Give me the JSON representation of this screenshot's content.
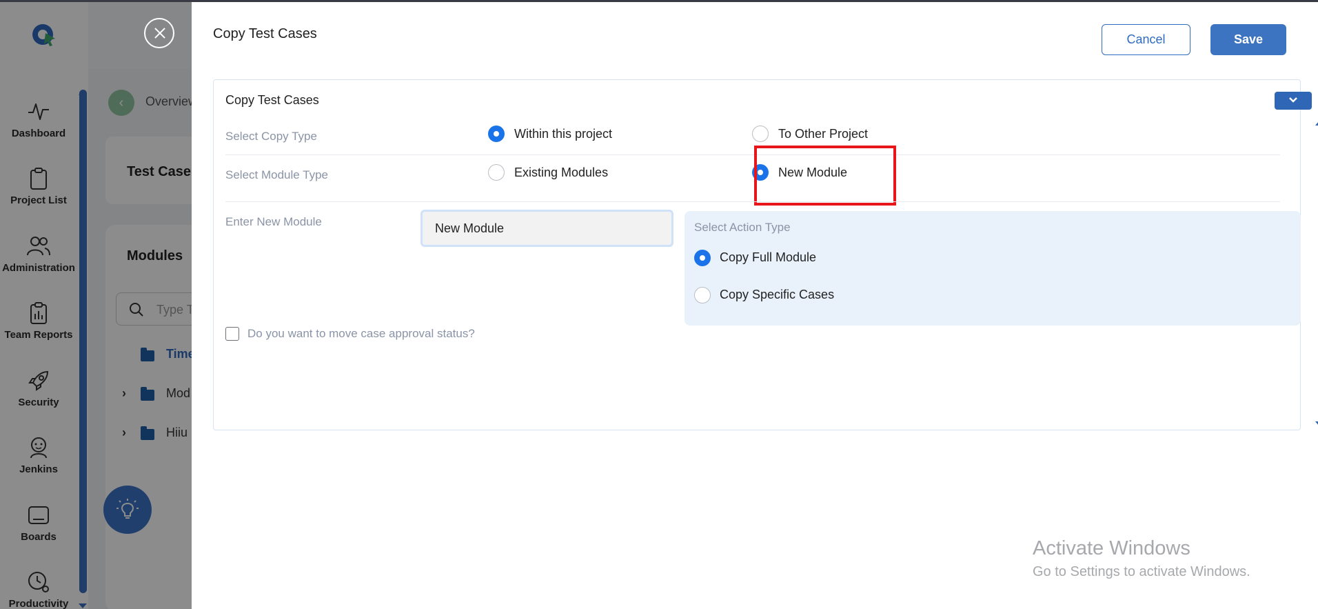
{
  "sidebar": {
    "items": [
      {
        "label": "Dashboard",
        "icon": "activity-icon"
      },
      {
        "label": "Project List",
        "icon": "clipboard-icon"
      },
      {
        "label": "Administration",
        "icon": "users-icon"
      },
      {
        "label": "Team Reports",
        "icon": "report-icon"
      },
      {
        "label": "Security",
        "icon": "rocket-icon"
      },
      {
        "label": "Jenkins",
        "icon": "jenkins-icon"
      },
      {
        "label": "Boards",
        "icon": "board-icon"
      },
      {
        "label": "Productivity",
        "icon": "clock-gear-icon"
      }
    ]
  },
  "background": {
    "breadcrumb": "Overview",
    "card_title": "Test Case",
    "modules_title": "Modules",
    "search_placeholder": "Type T",
    "tree": [
      {
        "label": "Time",
        "expandable": false
      },
      {
        "label": "Mod",
        "expandable": true
      },
      {
        "label": "Hiiu",
        "expandable": true
      }
    ]
  },
  "drawer": {
    "title": "Copy Test Cases",
    "cancel_label": "Cancel",
    "save_label": "Save",
    "panel_title": "Copy Test Cases",
    "copy_type": {
      "label": "Select Copy Type",
      "options": [
        {
          "label": "Within this project",
          "selected": true
        },
        {
          "label": "To Other Project",
          "selected": false
        }
      ]
    },
    "module_type": {
      "label": "Select Module Type",
      "options": [
        {
          "label": "Existing Modules",
          "selected": false
        },
        {
          "label": "New Module",
          "selected": true
        }
      ]
    },
    "new_module": {
      "label": "Enter New Module",
      "value": "New Module"
    },
    "action_type": {
      "label": "Select Action Type",
      "options": [
        {
          "label": "Copy Full Module",
          "selected": true
        },
        {
          "label": "Copy Specific Cases",
          "selected": false
        }
      ]
    },
    "approval_checkbox": {
      "label": "Do you want to move case approval status?",
      "checked": false
    }
  },
  "watermark": {
    "line1": "Activate Windows",
    "line2": "Go to Settings to activate Windows."
  },
  "colors": {
    "accent": "#1a73e8",
    "save_button": "#3d74c1",
    "highlight": "#e8161b",
    "action_box_bg": "#e9f1fb"
  }
}
